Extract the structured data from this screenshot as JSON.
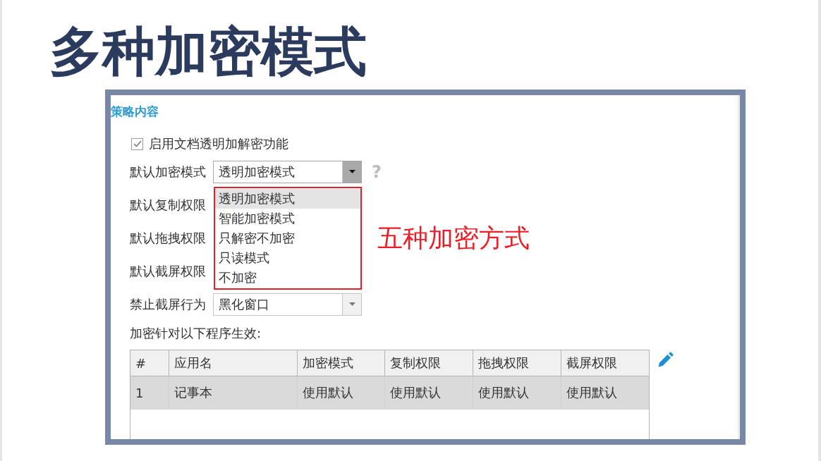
{
  "slide_title": "多种加密模式",
  "screenshot": {
    "section_title": "策略内容",
    "encryption_toggle": {
      "label": "启用文档透明加解密功能",
      "checked": true
    },
    "settings": [
      {
        "kind": "select",
        "label": "默认加密模式",
        "value": "透明加密模式",
        "expanded": true,
        "help": "?",
        "options": [
          {
            "label": "透明加密模式",
            "selected": true
          },
          {
            "label": "智能加密模式",
            "selected": false
          },
          {
            "label": "只解密不加密",
            "selected": false
          },
          {
            "label": "只读模式",
            "selected": false
          },
          {
            "label": "不加密",
            "selected": false
          }
        ],
        "callout": "五种加密方式"
      },
      {
        "kind": "label_only",
        "label": "默认复制权限"
      },
      {
        "kind": "label_only",
        "label": "默认拖拽权限"
      },
      {
        "kind": "label_only",
        "label": "默认截屏权限"
      },
      {
        "kind": "select",
        "label": "禁止截屏行为",
        "value": "黑化窗口",
        "expanded": false
      }
    ],
    "table_caption": "加密针对以下程序生效:",
    "table": {
      "columns": [
        "#",
        "应用名",
        "加密模式",
        "复制权限",
        "拖拽权限",
        "截屏权限"
      ],
      "rows": [
        {
          "cells": [
            "1",
            "记事本",
            "使用默认",
            "使用默认",
            "使用默认",
            "使用默认"
          ],
          "selected": true
        }
      ]
    }
  }
}
